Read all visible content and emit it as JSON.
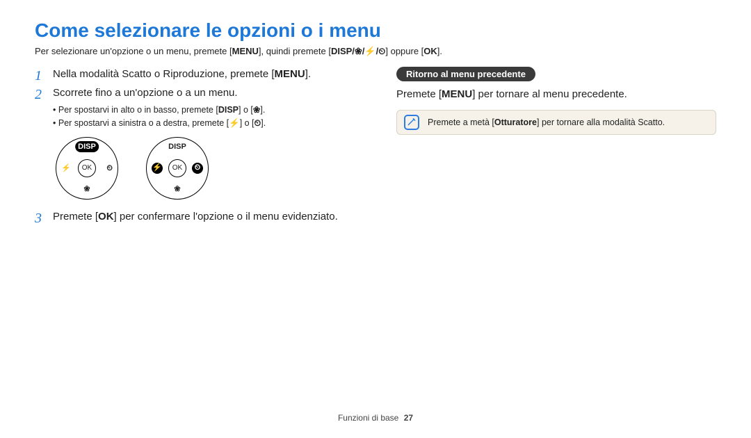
{
  "title": "Come selezionare le opzioni o i menu",
  "intro_pre": "Per selezionare un'opzione o un menu, premete [",
  "intro_menu": "MENU",
  "intro_mid": "], quindi premete [",
  "intro_seq": "DISP/❀/⚡/⏲",
  "intro_or": "] oppure [",
  "intro_ok": "OK",
  "intro_end": "].",
  "step1_pre": "Nella modalità Scatto o Riproduzione, premete [",
  "step1_menu": "MENU",
  "step1_end": "].",
  "step2": "Scorrete fino a un'opzione o a un menu.",
  "bullet1_pre": "Per spostarvi in alto o in basso, premete [",
  "bullet1_a": "DISP",
  "bullet1_mid": "] o [",
  "bullet1_b": "❀",
  "bullet1_end": "].",
  "bullet2_pre": "Per spostarvi a sinistra o a destra, premete [",
  "bullet2_a": "⚡",
  "bullet2_mid": "] o [",
  "bullet2_b": "⏲",
  "bullet2_end": "].",
  "dial_disp": "DISP",
  "dial_ok": "OK",
  "dial_flash": "⚡",
  "dial_timer": "⏲",
  "dial_macro": "❀",
  "step3_pre": "Premete [",
  "step3_ok": "OK",
  "step3_end": "] per confermare l'opzione o il menu evidenziato.",
  "badge": "Ritorno al menu precedente",
  "right_pre": "Premete [",
  "right_menu": "MENU",
  "right_end": "] per tornare al menu precedente.",
  "tip_pre": "Premete a metà [",
  "tip_bold": "Otturatore",
  "tip_end": "] per tornare alla modalità Scatto.",
  "footer_label": "Funzioni di base",
  "footer_page": "27"
}
